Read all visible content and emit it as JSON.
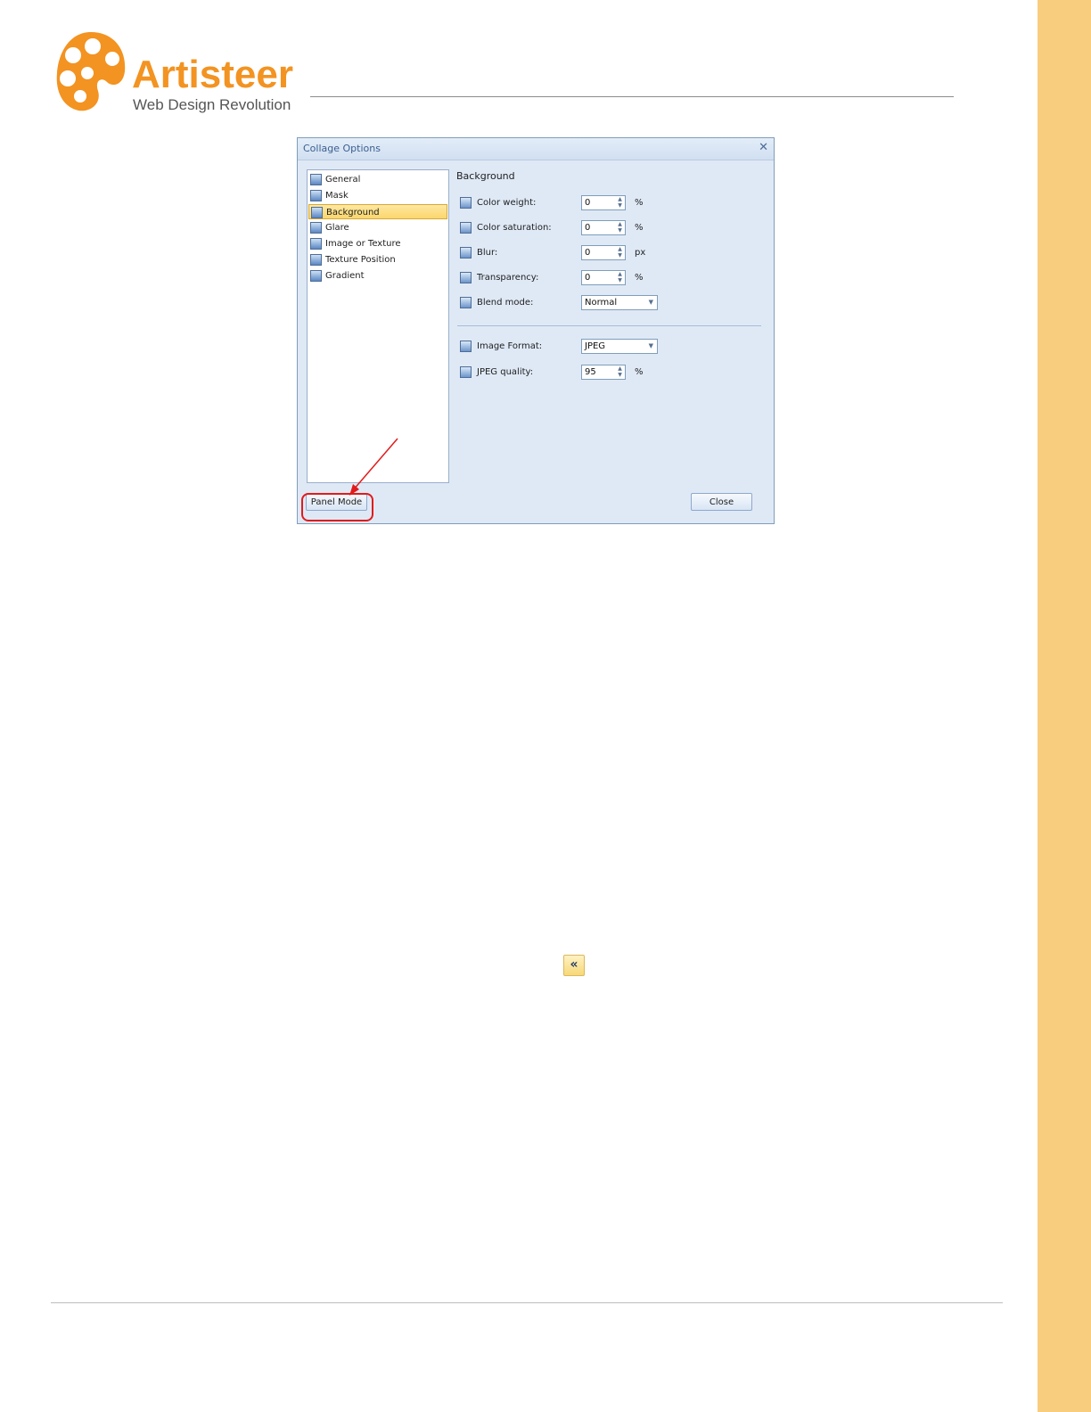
{
  "logo": {
    "title": "Artisteer",
    "subtitle": "Web Design Revolution",
    "color": "#f39321"
  },
  "dialog": {
    "title": "Collage Options",
    "nav_items": [
      {
        "label": "General",
        "icon": "general-icon",
        "selected": false
      },
      {
        "label": "Mask",
        "icon": "mask-icon",
        "selected": false
      },
      {
        "label": "Background",
        "icon": "background-icon",
        "selected": true
      },
      {
        "label": "Glare",
        "icon": "glare-icon",
        "selected": false
      },
      {
        "label": "Image or Texture",
        "icon": "image-texture-icon",
        "selected": false
      },
      {
        "label": "Texture Position",
        "icon": "texture-position-icon",
        "selected": false
      },
      {
        "label": "Gradient",
        "icon": "gradient-icon",
        "selected": false
      }
    ],
    "section_title": "Background",
    "fields": {
      "color_weight": {
        "label": "Color weight:",
        "value": "0",
        "unit": "%"
      },
      "color_saturation": {
        "label": "Color saturation:",
        "value": "0",
        "unit": "%"
      },
      "blur": {
        "label": "Blur:",
        "value": "0",
        "unit": "px"
      },
      "transparency": {
        "label": "Transparency:",
        "value": "0",
        "unit": "%"
      },
      "blend_mode": {
        "label": "Blend mode:",
        "value": "Normal"
      },
      "image_format": {
        "label": "Image Format:",
        "value": "JPEG"
      },
      "jpeg_quality": {
        "label": "JPEG quality:",
        "value": "95",
        "unit": "%"
      }
    },
    "buttons": {
      "panel_mode": "Panel Mode",
      "close": "Close"
    }
  },
  "collapse_button": {
    "label": "«"
  },
  "colors": {
    "side_band": "#f8cd7d",
    "highlight": "#e11b1b"
  }
}
